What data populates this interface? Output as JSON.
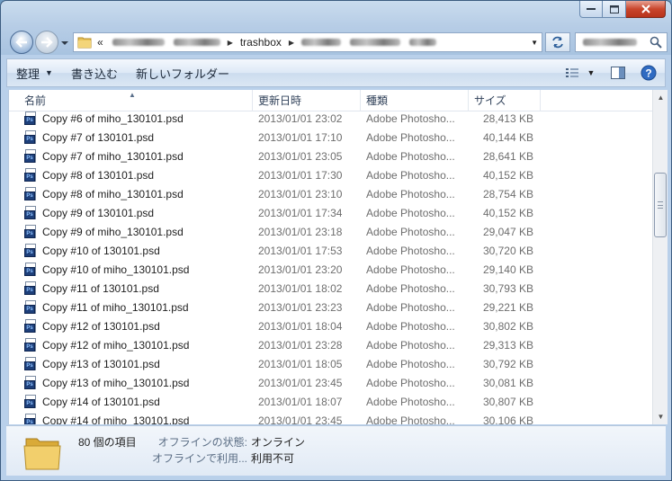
{
  "window": {
    "caption_buttons": [
      "minimize",
      "maximize",
      "close"
    ]
  },
  "address": {
    "prefix": "«",
    "folder": "trashbox",
    "search_placeholder": ""
  },
  "toolbar": {
    "organize": "整理",
    "burn": "書き込む",
    "new_folder": "新しいフォルダー"
  },
  "columns": {
    "name": "名前",
    "date": "更新日時",
    "type": "種類",
    "size": "サイズ"
  },
  "files": [
    {
      "name": "Copy #6 of miho_130101.psd",
      "date": "2013/01/01 23:02",
      "type": "Adobe Photosho...",
      "size": "28,413 KB"
    },
    {
      "name": "Copy #7 of 130101.psd",
      "date": "2013/01/01 17:10",
      "type": "Adobe Photosho...",
      "size": "40,144 KB"
    },
    {
      "name": "Copy #7 of miho_130101.psd",
      "date": "2013/01/01 23:05",
      "type": "Adobe Photosho...",
      "size": "28,641 KB"
    },
    {
      "name": "Copy #8 of 130101.psd",
      "date": "2013/01/01 17:30",
      "type": "Adobe Photosho...",
      "size": "40,152 KB"
    },
    {
      "name": "Copy #8 of miho_130101.psd",
      "date": "2013/01/01 23:10",
      "type": "Adobe Photosho...",
      "size": "28,754 KB"
    },
    {
      "name": "Copy #9 of 130101.psd",
      "date": "2013/01/01 17:34",
      "type": "Adobe Photosho...",
      "size": "40,152 KB"
    },
    {
      "name": "Copy #9 of miho_130101.psd",
      "date": "2013/01/01 23:18",
      "type": "Adobe Photosho...",
      "size": "29,047 KB"
    },
    {
      "name": "Copy #10 of 130101.psd",
      "date": "2013/01/01 17:53",
      "type": "Adobe Photosho...",
      "size": "30,720 KB"
    },
    {
      "name": "Copy #10 of miho_130101.psd",
      "date": "2013/01/01 23:20",
      "type": "Adobe Photosho...",
      "size": "29,140 KB"
    },
    {
      "name": "Copy #11 of 130101.psd",
      "date": "2013/01/01 18:02",
      "type": "Adobe Photosho...",
      "size": "30,793 KB"
    },
    {
      "name": "Copy #11 of miho_130101.psd",
      "date": "2013/01/01 23:23",
      "type": "Adobe Photosho...",
      "size": "29,221 KB"
    },
    {
      "name": "Copy #12 of 130101.psd",
      "date": "2013/01/01 18:04",
      "type": "Adobe Photosho...",
      "size": "30,802 KB"
    },
    {
      "name": "Copy #12 of miho_130101.psd",
      "date": "2013/01/01 23:28",
      "type": "Adobe Photosho...",
      "size": "29,313 KB"
    },
    {
      "name": "Copy #13 of 130101.psd",
      "date": "2013/01/01 18:05",
      "type": "Adobe Photosho...",
      "size": "30,792 KB"
    },
    {
      "name": "Copy #13 of miho_130101.psd",
      "date": "2013/01/01 23:45",
      "type": "Adobe Photosho...",
      "size": "30,081 KB"
    },
    {
      "name": "Copy #14 of 130101.psd",
      "date": "2013/01/01 18:07",
      "type": "Adobe Photosho...",
      "size": "30,807 KB"
    },
    {
      "name": "Copy #14 of miho_130101.psd",
      "date": "2013/01/01 23:45",
      "type": "Adobe Photosho...",
      "size": "30,106 KB"
    }
  ],
  "details": {
    "item_count": "80 個の項目",
    "offline_status_label": "オフラインの状態:",
    "offline_status_value": "オンライン",
    "offline_use_label": "オフラインで利用...",
    "offline_use_value": "利用不可"
  },
  "colors": {
    "accent": "#2d5f9a",
    "ps_icon": "#1d3f7a",
    "close_button": "#c9462c"
  }
}
